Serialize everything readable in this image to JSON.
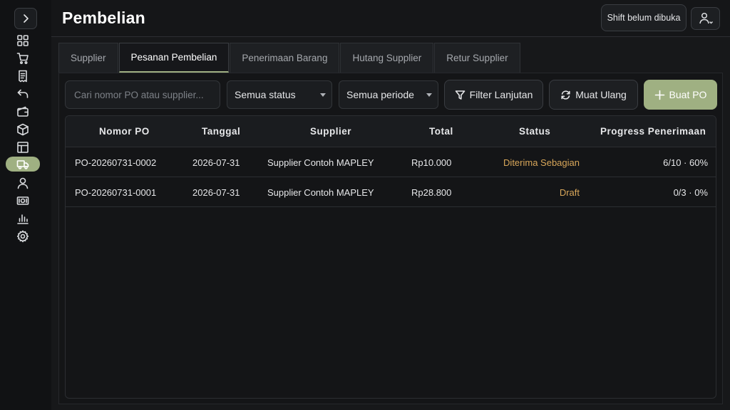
{
  "header": {
    "title": "Pembelian",
    "shift_label": "Shift belum dibuka"
  },
  "sidebar": {
    "items": [
      {
        "icon": "dashboard-icon"
      },
      {
        "icon": "cart-icon"
      },
      {
        "icon": "receipt-icon"
      },
      {
        "icon": "return-icon"
      },
      {
        "icon": "wallet-icon"
      },
      {
        "icon": "box-icon"
      },
      {
        "icon": "table-icon"
      },
      {
        "icon": "truck-icon",
        "active": true
      },
      {
        "icon": "user-icon"
      },
      {
        "icon": "money-icon"
      },
      {
        "icon": "chart-icon"
      },
      {
        "icon": "gear-icon"
      }
    ],
    "accent": "#9fb082"
  },
  "tabs": [
    {
      "label": "Supplier"
    },
    {
      "label": "Pesanan Pembelian",
      "active": true
    },
    {
      "label": "Penerimaan Barang"
    },
    {
      "label": "Hutang Supplier"
    },
    {
      "label": "Retur Supplier"
    }
  ],
  "toolbar": {
    "search_placeholder": "Cari nomor PO atau supplier...",
    "status_select": "Semua status",
    "period_select": "Semua periode",
    "filter_label": "Filter Lanjutan",
    "reload_label": "Muat Ulang",
    "create_label": "Buat PO"
  },
  "table": {
    "columns": [
      "Nomor PO",
      "Tanggal",
      "Supplier",
      "Total",
      "Status",
      "Progress Penerimaan"
    ],
    "rows": [
      {
        "po": "PO-20260731-0002",
        "date": "2026-07-31",
        "supplier": "Supplier Contoh MAPLEY",
        "total": "Rp10.000",
        "status": "Diterima Sebagian",
        "progress": "6/10 · 60%"
      },
      {
        "po": "PO-20260731-0001",
        "date": "2026-07-31",
        "supplier": "Supplier Contoh MAPLEY",
        "total": "Rp28.800",
        "status": "Draft",
        "progress": "0/3 · 0%"
      }
    ]
  },
  "colors": {
    "accent": "#9fb082",
    "status_warning": "#d9a75a",
    "background": "#111214"
  }
}
